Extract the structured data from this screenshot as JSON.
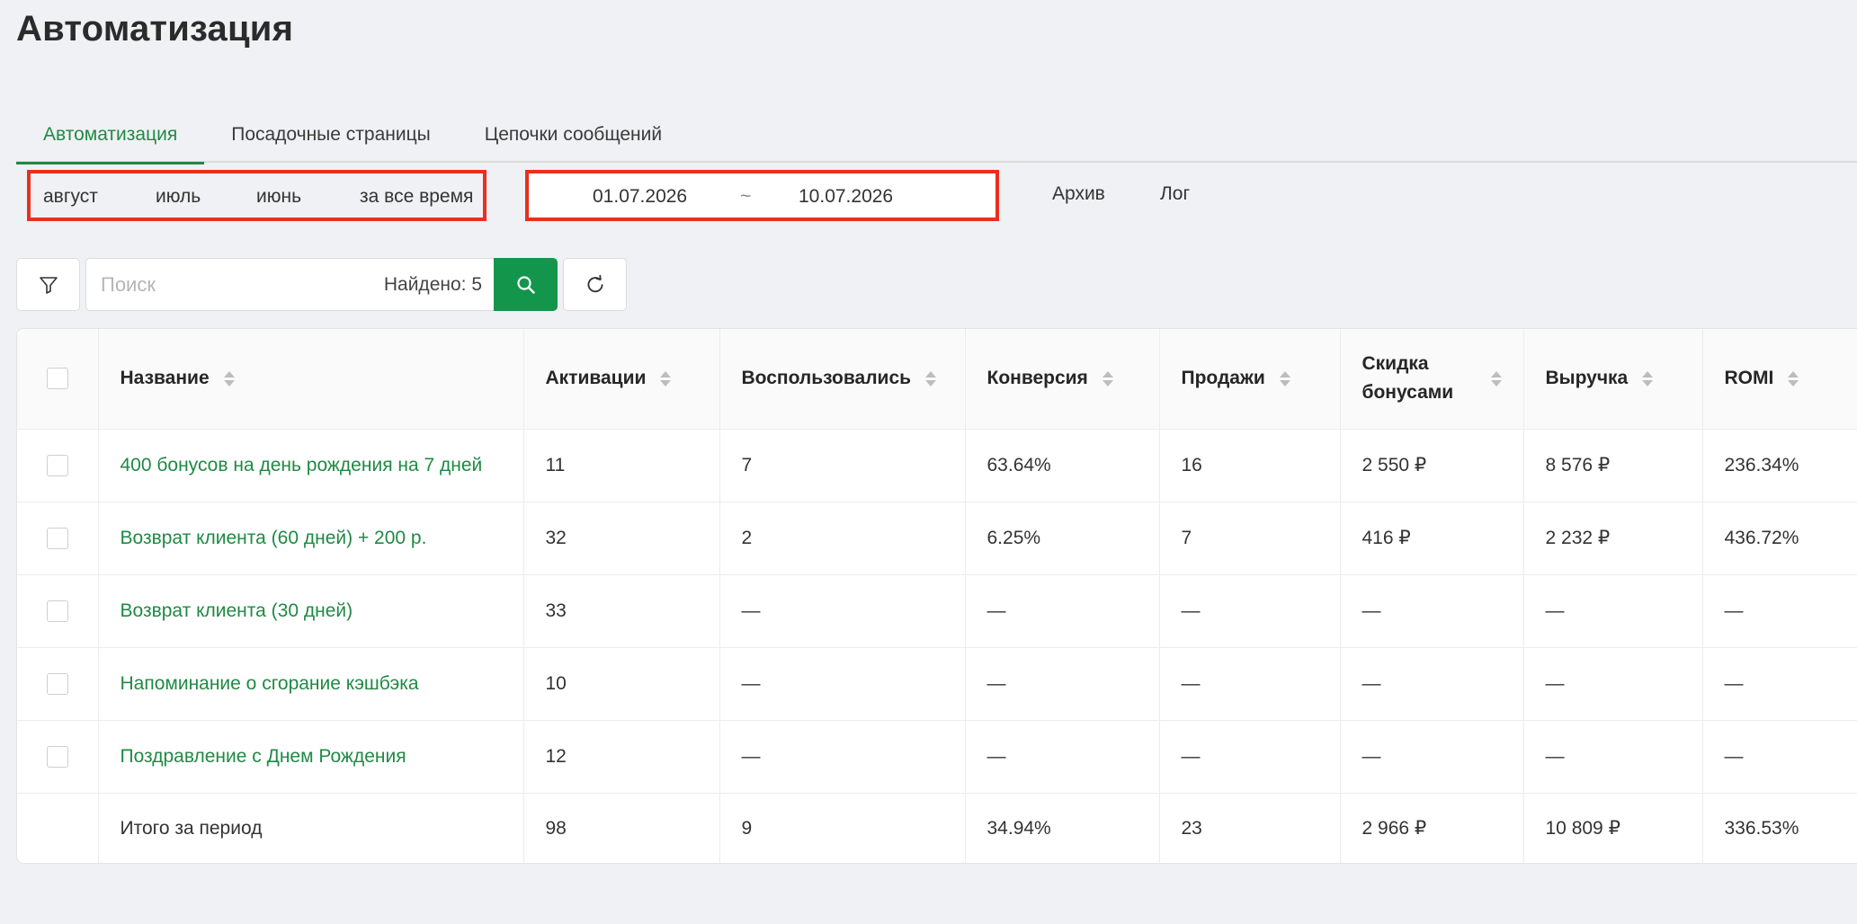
{
  "page": {
    "title": "Автоматизация"
  },
  "tabs": [
    {
      "label": "Автоматизация",
      "active": true
    },
    {
      "label": "Посадочные страницы",
      "active": false
    },
    {
      "label": "Цепочки сообщений",
      "active": false
    }
  ],
  "periods": [
    "август",
    "июль",
    "июнь",
    "за все время"
  ],
  "date_range": {
    "start": "01.07.2026",
    "separator": "~",
    "end": "10.07.2026"
  },
  "links": {
    "archive": "Архив",
    "log": "Лог"
  },
  "search": {
    "placeholder": "Поиск",
    "value": "",
    "found": "Найдено: 5"
  },
  "icons": {
    "filter": "filter-icon",
    "search": "search-icon",
    "refresh": "refresh-icon",
    "sort": "sort-icon"
  },
  "colors": {
    "accent": "#1f8a44",
    "button": "#13964b",
    "highlight": "#e8301f"
  },
  "table": {
    "columns": [
      "Название",
      "Активации",
      "Воспользовались",
      "Конверсия",
      "Продажи",
      "Скидка бонусами",
      "Выручка",
      "ROMI"
    ],
    "rows": [
      [
        "400 бонусов на день рождения на 7 дней",
        "11",
        "7",
        "63.64%",
        "16",
        "2 550 ₽",
        "8 576 ₽",
        "236.34%"
      ],
      [
        "Возврат клиента (60 дней) + 200 р.",
        "32",
        "2",
        "6.25%",
        "7",
        "416 ₽",
        "2 232 ₽",
        "436.72%"
      ],
      [
        "Возврат клиента (30 дней)",
        "33",
        "—",
        "—",
        "—",
        "—",
        "—",
        "—"
      ],
      [
        "Напоминание о сгорание кэшбэка",
        "10",
        "—",
        "—",
        "—",
        "—",
        "—",
        "—"
      ],
      [
        "Поздравление с Днем Рождения",
        "12",
        "—",
        "—",
        "—",
        "—",
        "—",
        "—"
      ]
    ],
    "total": [
      "Итого за период",
      "98",
      "9",
      "34.94%",
      "23",
      "2 966 ₽",
      "10 809 ₽",
      "336.53%"
    ]
  }
}
